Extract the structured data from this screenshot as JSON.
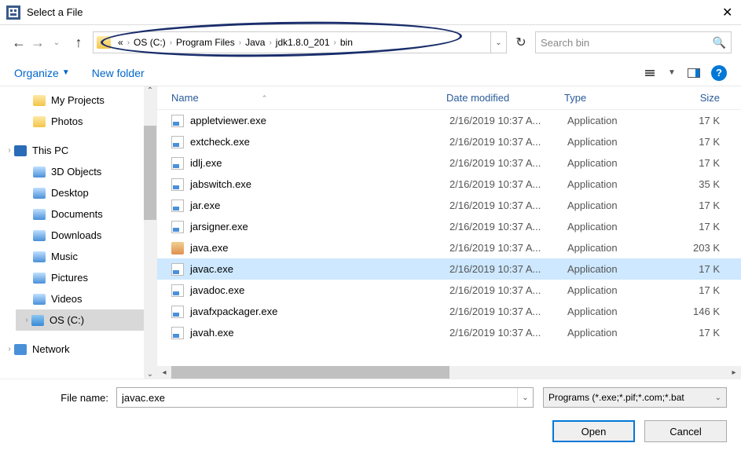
{
  "window": {
    "title": "Select a File"
  },
  "breadcrumb": {
    "items": [
      "«",
      "OS (C:)",
      "Program Files",
      "Java",
      "jdk1.8.0_201",
      "bin"
    ]
  },
  "search": {
    "placeholder": "Search bin"
  },
  "toolbar": {
    "organize": "Organize",
    "newfolder": "New folder"
  },
  "tree": {
    "items": [
      {
        "label": "My Projects",
        "icon": "folder",
        "indent": 2
      },
      {
        "label": "Photos",
        "icon": "folder",
        "indent": 2
      },
      {
        "label": "This PC",
        "icon": "pc",
        "indent": 0,
        "root": true,
        "expand": true
      },
      {
        "label": "3D Objects",
        "icon": "spec",
        "indent": 2
      },
      {
        "label": "Desktop",
        "icon": "spec",
        "indent": 2
      },
      {
        "label": "Documents",
        "icon": "spec",
        "indent": 2
      },
      {
        "label": "Downloads",
        "icon": "spec",
        "indent": 2
      },
      {
        "label": "Music",
        "icon": "spec",
        "indent": 2
      },
      {
        "label": "Pictures",
        "icon": "spec",
        "indent": 2
      },
      {
        "label": "Videos",
        "icon": "spec",
        "indent": 2
      },
      {
        "label": "OS (C:)",
        "icon": "disk",
        "indent": 2,
        "selected": true,
        "expand": true
      },
      {
        "label": "Network",
        "icon": "net",
        "indent": 0,
        "root": true,
        "expand": true
      }
    ]
  },
  "columns": {
    "name": "Name",
    "date": "Date modified",
    "type": "Type",
    "size": "Size"
  },
  "files": [
    {
      "name": "appletviewer.exe",
      "date": "2/16/2019 10:37 A...",
      "type": "Application",
      "size": "17 K",
      "ico": "exe"
    },
    {
      "name": "extcheck.exe",
      "date": "2/16/2019 10:37 A...",
      "type": "Application",
      "size": "17 K",
      "ico": "exe"
    },
    {
      "name": "idlj.exe",
      "date": "2/16/2019 10:37 A...",
      "type": "Application",
      "size": "17 K",
      "ico": "exe"
    },
    {
      "name": "jabswitch.exe",
      "date": "2/16/2019 10:37 A...",
      "type": "Application",
      "size": "35 K",
      "ico": "exe"
    },
    {
      "name": "jar.exe",
      "date": "2/16/2019 10:37 A...",
      "type": "Application",
      "size": "17 K",
      "ico": "exe"
    },
    {
      "name": "jarsigner.exe",
      "date": "2/16/2019 10:37 A...",
      "type": "Application",
      "size": "17 K",
      "ico": "exe"
    },
    {
      "name": "java.exe",
      "date": "2/16/2019 10:37 A...",
      "type": "Application",
      "size": "203 K",
      "ico": "java"
    },
    {
      "name": "javac.exe",
      "date": "2/16/2019 10:37 A...",
      "type": "Application",
      "size": "17 K",
      "ico": "exe",
      "selected": true
    },
    {
      "name": "javadoc.exe",
      "date": "2/16/2019 10:37 A...",
      "type": "Application",
      "size": "17 K",
      "ico": "exe"
    },
    {
      "name": "javafxpackager.exe",
      "date": "2/16/2019 10:37 A...",
      "type": "Application",
      "size": "146 K",
      "ico": "exe"
    },
    {
      "name": "javah.exe",
      "date": "2/16/2019 10:37 A...",
      "type": "Application",
      "size": "17 K",
      "ico": "exe"
    }
  ],
  "footer": {
    "label": "File name:",
    "filename": "javac.exe",
    "filter": "Programs (*.exe;*.pif;*.com;*.bat",
    "open": "Open",
    "cancel": "Cancel"
  }
}
